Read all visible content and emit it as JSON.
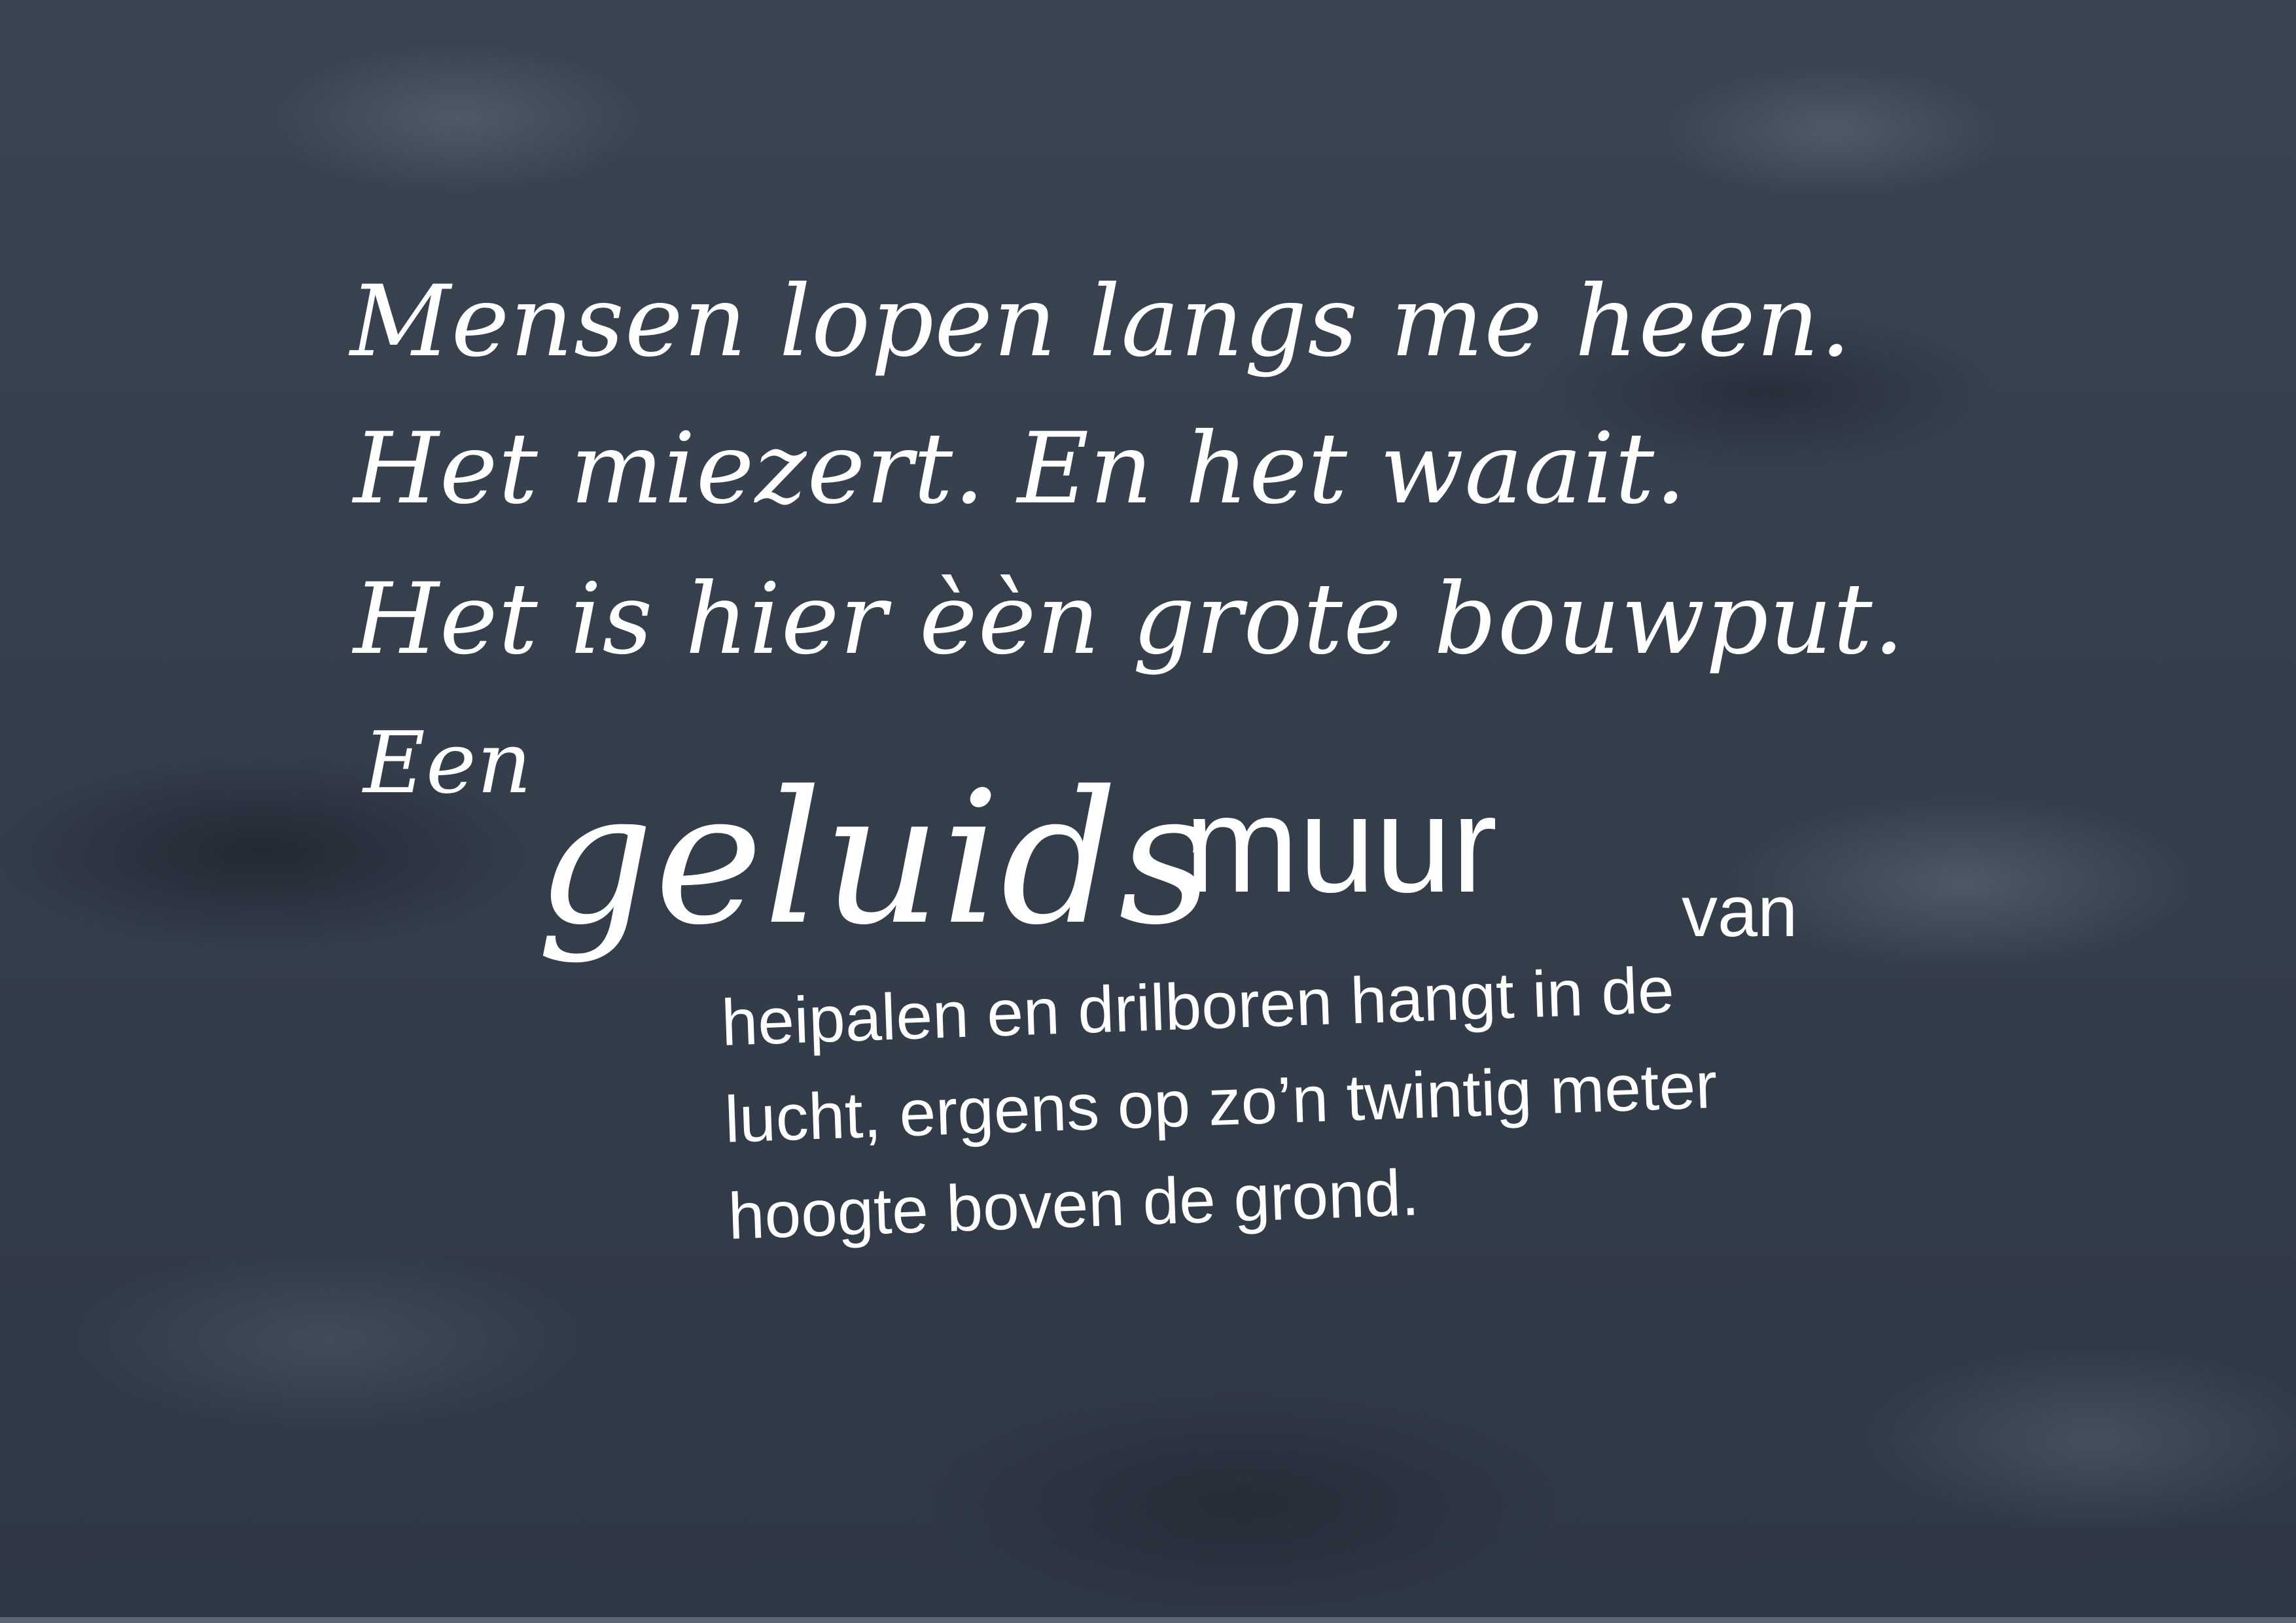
{
  "poem": {
    "line1": "Mensen lopen langs me heen.",
    "line2": "Het miezert. En het waait.",
    "line3": "Het is hier èèn grote bouwput.",
    "word_een": "Een",
    "word_geluids": "geluids",
    "word_muur": "muur",
    "word_van": "van",
    "para_lines": [
      "heipalen en drilboren hangt in de",
      "lucht, ergens op zo’n twintig meter",
      "hoogte boven de grond."
    ]
  },
  "colors": {
    "background": "#36404d",
    "text": "#ffffff",
    "bottom_strip": "#5c6673"
  }
}
